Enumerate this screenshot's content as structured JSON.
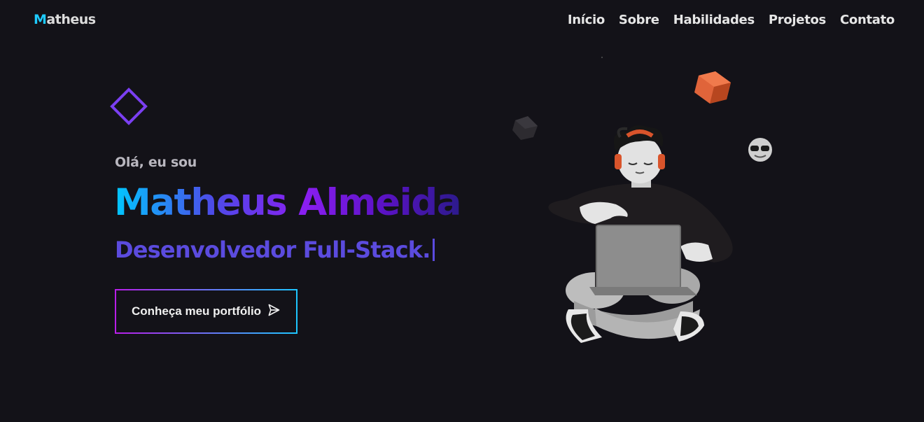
{
  "header": {
    "logo_first": "M",
    "logo_rest": "atheus",
    "nav": [
      "Início",
      "Sobre",
      "Habilidades",
      "Projetos",
      "Contato"
    ]
  },
  "hero": {
    "greeting": "Olá, eu sou",
    "name": "Matheus Almeida",
    "role": "Desenvolvedor Full-Stack.",
    "cta_label": "Conheça meu portfólio"
  },
  "colors": {
    "background": "#131218",
    "accent_cyan": "#1ecbff",
    "accent_purple": "#7b3ff2",
    "role_text": "#5b4bde",
    "cube_orange": "#d9542b"
  },
  "icons": {
    "cta_icon": "paper-plane-icon",
    "decor": [
      "diamond-outline-icon",
      "orange-cube",
      "dark-cube",
      "sunglasses-emoji"
    ]
  }
}
